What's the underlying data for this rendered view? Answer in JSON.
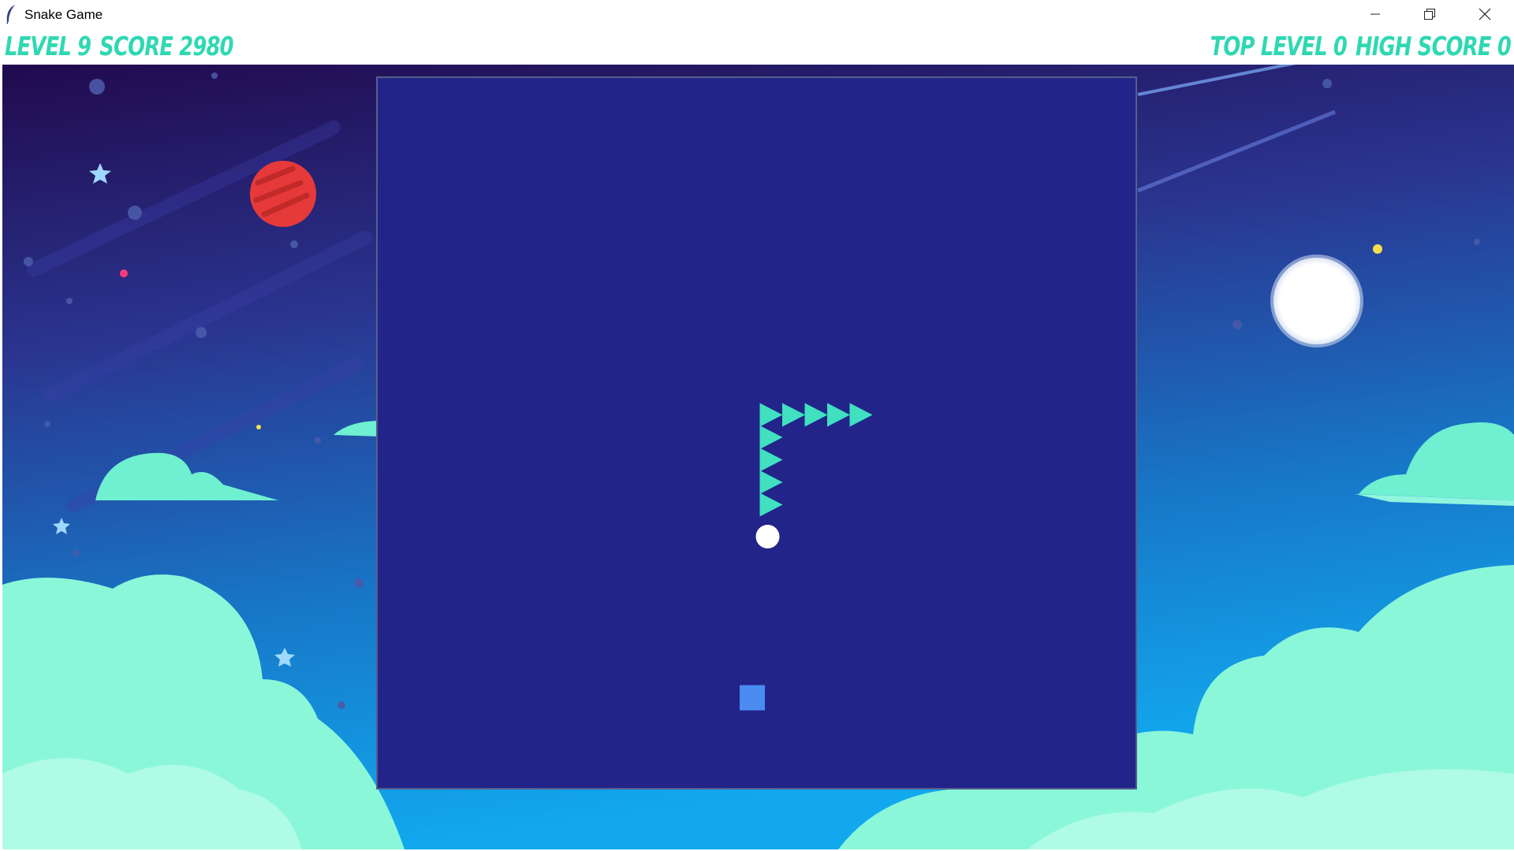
{
  "window": {
    "title": "Snake Game",
    "minimize_icon": "minimize-icon",
    "restore_icon": "restore-icon",
    "close_icon": "close-icon"
  },
  "hud": {
    "level_label": "LEVEL",
    "level_value": "9",
    "score_label": "SCORE",
    "score_value": "2980",
    "top_level_label": "TOP LEVEL",
    "top_level_value": "0",
    "high_score_label": "HIGH SCORE",
    "high_score_value": "0"
  },
  "colors": {
    "hud_text": "#2fd8b2",
    "board": "#22248a",
    "snake": "#40e0c0",
    "snake_head": "#ffffff",
    "food": "#4a8cf0"
  },
  "game": {
    "grid_cell": "cell",
    "snake_head_direction": "down",
    "snake": [
      {
        "col": 17,
        "row": 15,
        "part": "tail"
      },
      {
        "col": 18,
        "row": 15
      },
      {
        "col": 19,
        "row": 15
      },
      {
        "col": 20,
        "row": 15
      },
      {
        "col": 21,
        "row": 15
      },
      {
        "col": 17,
        "row": 16
      },
      {
        "col": 17,
        "row": 17
      },
      {
        "col": 17,
        "row": 18
      },
      {
        "col": 17,
        "row": 19
      },
      {
        "col": 17,
        "row": 20,
        "part": "head"
      }
    ],
    "food": {
      "col": 16,
      "row": 27
    }
  }
}
